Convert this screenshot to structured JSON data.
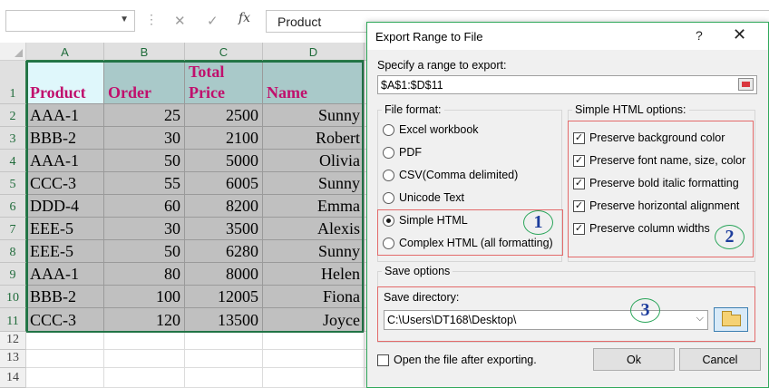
{
  "formula_bar": {
    "name_box": "",
    "fx_label": "fx",
    "content": "Product"
  },
  "sheet": {
    "columns": [
      "A",
      "B",
      "C",
      "D"
    ],
    "rows": [
      "1",
      "2",
      "3",
      "4",
      "5",
      "6",
      "7",
      "8",
      "9",
      "10",
      "11",
      "12",
      "13",
      "14"
    ],
    "headers": {
      "product": "Product",
      "order": "Order",
      "total_line1": "Total",
      "total_line2": "Price",
      "name": "Name"
    },
    "data": [
      {
        "product": "AAA-1",
        "order": "25",
        "total": "2500",
        "name": "Sunny"
      },
      {
        "product": "BBB-2",
        "order": "30",
        "total": "2100",
        "name": "Robert"
      },
      {
        "product": "AAA-1",
        "order": "50",
        "total": "5000",
        "name": "Olivia"
      },
      {
        "product": "CCC-3",
        "order": "55",
        "total": "6005",
        "name": "Sunny"
      },
      {
        "product": "DDD-4",
        "order": "60",
        "total": "8200",
        "name": "Emma"
      },
      {
        "product": "EEE-5",
        "order": "30",
        "total": "3500",
        "name": "Alexis"
      },
      {
        "product": "EEE-5",
        "order": "50",
        "total": "6280",
        "name": "Sunny"
      },
      {
        "product": "AAA-1",
        "order": "80",
        "total": "8000",
        "name": "Helen"
      },
      {
        "product": "BBB-2",
        "order": "100",
        "total": "12005",
        "name": "Fiona"
      },
      {
        "product": "CCC-3",
        "order": "120",
        "total": "13500",
        "name": "Joyce"
      }
    ]
  },
  "dialog": {
    "title": "Export Range to File",
    "help": "?",
    "close": "✕",
    "range_label": "Specify a range to export:",
    "range_value": "$A$1:$D$11",
    "file_format": {
      "title": "File format:",
      "options": [
        {
          "label": "Excel workbook",
          "selected": false
        },
        {
          "label": "PDF",
          "selected": false
        },
        {
          "label": "CSV(Comma delimited)",
          "selected": false
        },
        {
          "label": "Unicode Text",
          "selected": false
        },
        {
          "label": "Simple HTML",
          "selected": true
        },
        {
          "label": "Complex HTML (all formatting)",
          "selected": false
        }
      ]
    },
    "html_options": {
      "title": "Simple HTML options:",
      "options": [
        {
          "label": "Preserve background color",
          "checked": true
        },
        {
          "label": "Preserve font name, size, color",
          "checked": true
        },
        {
          "label": "Preserve bold italic formatting",
          "checked": true
        },
        {
          "label": "Preserve horizontal alignment",
          "checked": true
        },
        {
          "label": "Preserve column widths",
          "checked": true
        }
      ]
    },
    "save_options": {
      "title": "Save options",
      "dir_label": "Save directory:",
      "dir_value": "C:\\Users\\DT168\\Desktop\\"
    },
    "open_after": {
      "label": "Open the file after exporting.",
      "checked": false
    },
    "ok_label": "Ok",
    "cancel_label": "Cancel",
    "callouts": [
      "1",
      "2",
      "3"
    ]
  },
  "colors": {
    "header_text": "#c0106d",
    "cell_fill": "#c0c0c0",
    "header_fill_a": "#dff7fb",
    "header_fill_other": "#a9c9c9",
    "selection": "#217346",
    "callout_ring": "#2aa55a",
    "callout_text": "#1c3c9c",
    "callout_box": "#e36a6a"
  }
}
